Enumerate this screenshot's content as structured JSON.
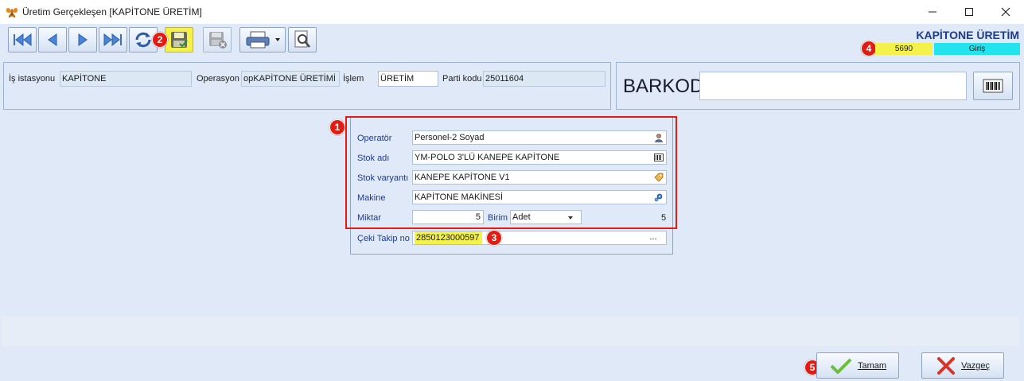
{
  "window": {
    "title": "Üretim Gerçekleşen [KAPİTONE ÜRETİM]"
  },
  "toolbar": {
    "buttons": [
      "first-record",
      "previous-record",
      "next-record",
      "last-record",
      "refresh",
      "save",
      "delete",
      "print",
      "preview"
    ]
  },
  "header": {
    "module_title": "KAPİTONE ÜRETİM",
    "doc_number": "5690",
    "mode": "Giriş"
  },
  "info": {
    "workstation_label": "İş istasyonu",
    "workstation_value": "KAPİTONE",
    "operation_label": "Operasyon",
    "operation_value": "opKAPİTONE ÜRETİMİ",
    "process_label": "İşlem",
    "process_value": "ÜRETİM",
    "lot_label": "Parti kodu",
    "lot_value": "25011604"
  },
  "barcode": {
    "label": "BARKOD",
    "value": ""
  },
  "form": {
    "operator_label": "Operatör",
    "operator_value": "Personel-2 Soyad",
    "stock_name_label": "Stok adı",
    "stock_name_value": "YM-POLO 3'LÜ KANEPE KAPİTONE",
    "stock_variant_label": "Stok varyantı",
    "stock_variant_value": "KANEPE KAPİTONE V1",
    "machine_label": "Makine",
    "machine_value": "KAPİTONE MAKİNESİ",
    "quantity_label": "Miktar",
    "quantity_value": "5",
    "unit_label": "Birim",
    "unit_value": "Adet",
    "quantity_summary": "5",
    "tracking_label": "Çeki Takip no",
    "tracking_value": "2850123000597",
    "tracking_button": "..."
  },
  "badges": [
    "1",
    "2",
    "3",
    "4",
    "5"
  ],
  "actions": {
    "ok_label": "Tamam",
    "cancel_label": "Vazgeç"
  },
  "colors": {
    "background": "#dfe9f7",
    "highlight_yellow": "#f4f24a",
    "mode_cyan": "#22e3ee",
    "badge_red": "#e21c12",
    "title_blue": "#1f3c8c"
  }
}
